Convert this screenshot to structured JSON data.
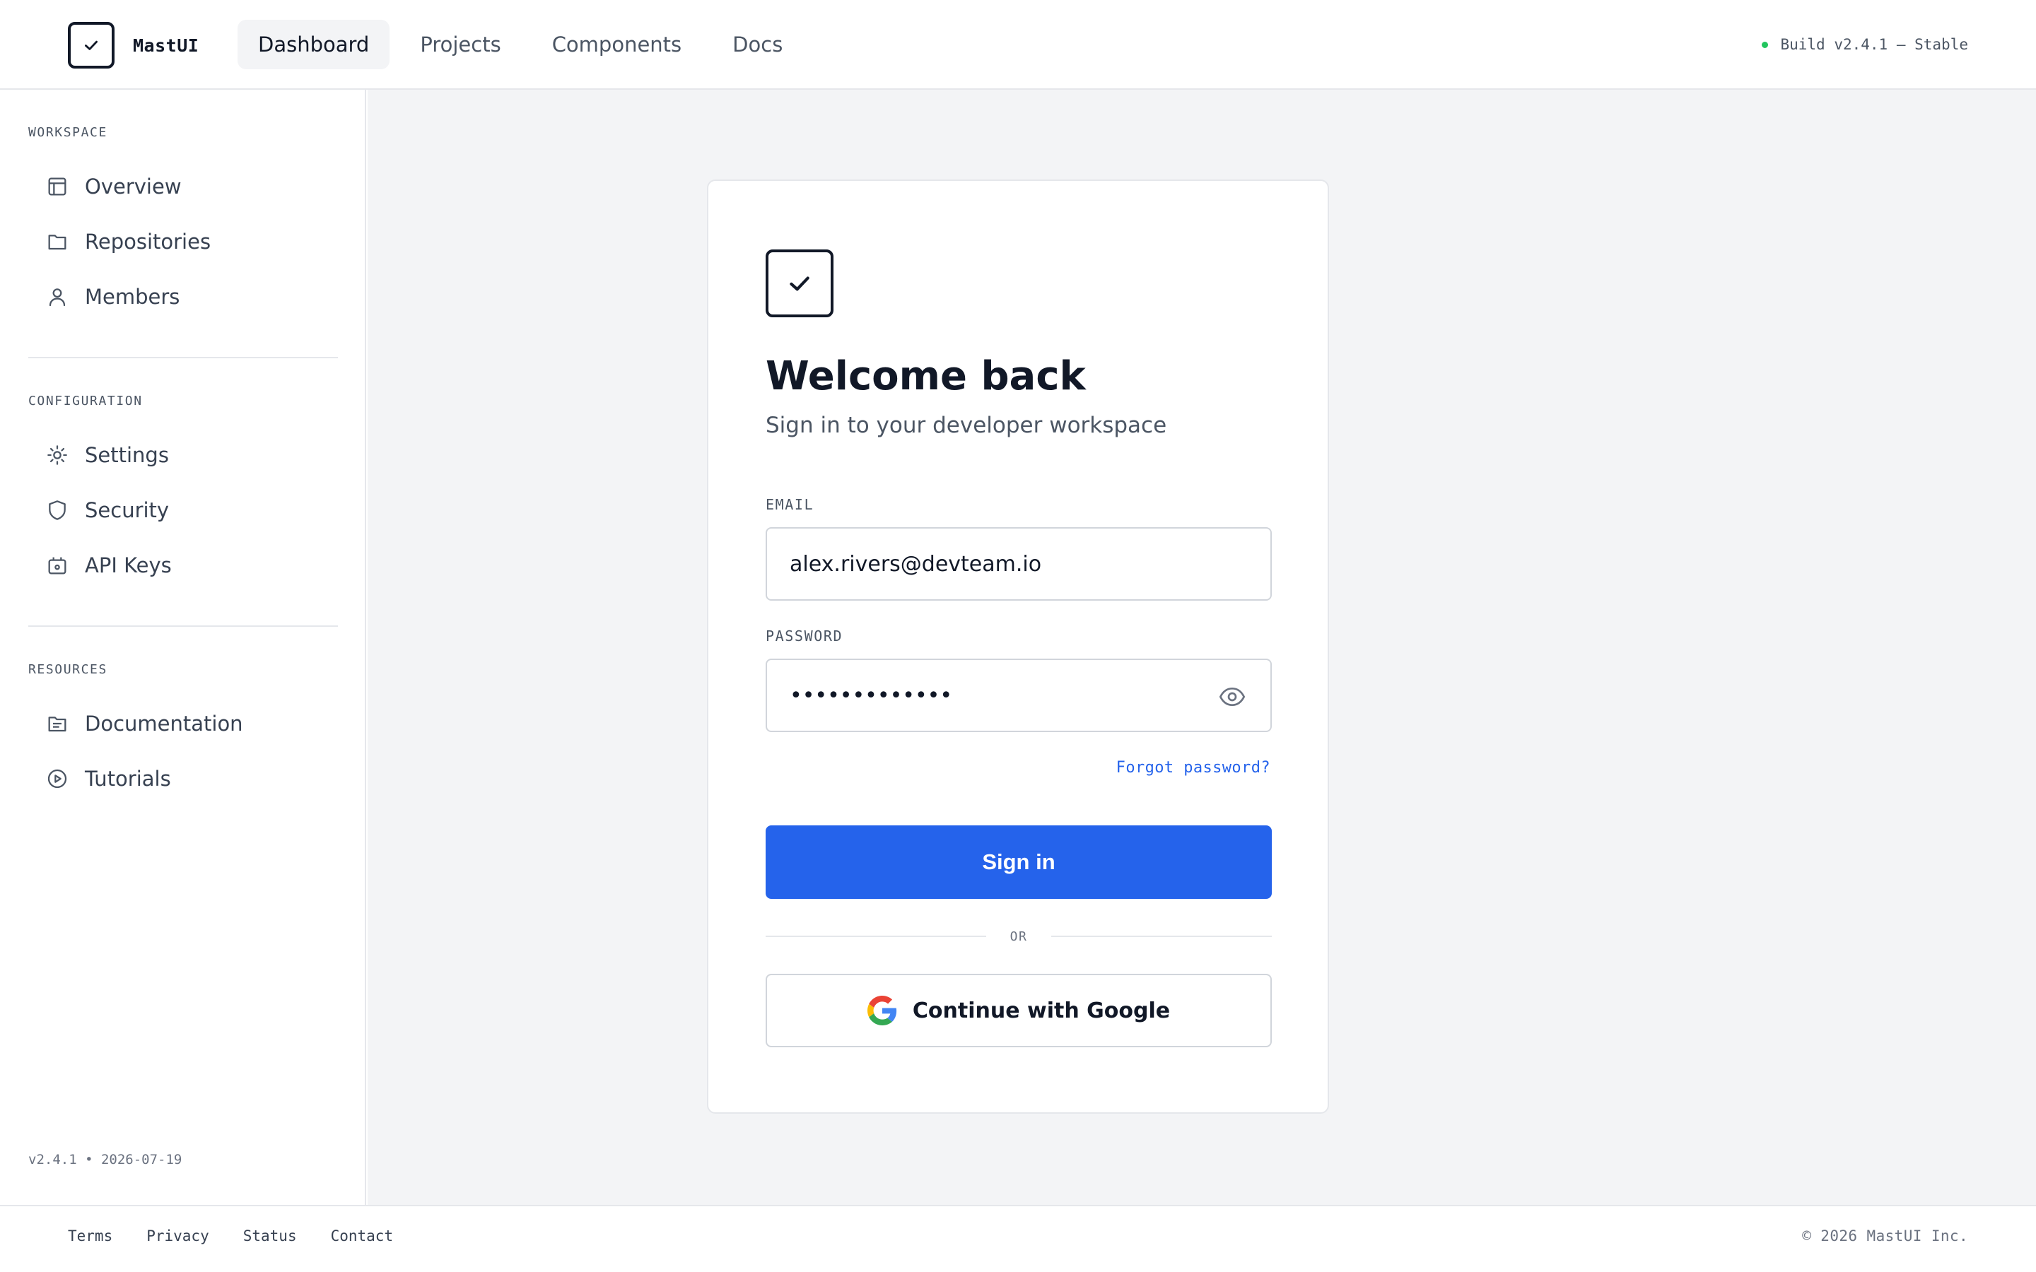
{
  "header": {
    "brand": "MastUI",
    "nav": [
      {
        "label": "Dashboard",
        "active": true
      },
      {
        "label": "Projects"
      },
      {
        "label": "Components"
      },
      {
        "label": "Docs"
      }
    ],
    "build_status": "Build v2.4.1 — Stable",
    "status_color": "#22c55e"
  },
  "sidebar": {
    "sections": [
      {
        "title": "WORKSPACE",
        "items": [
          {
            "label": "Overview",
            "icon": "layout-icon"
          },
          {
            "label": "Repositories",
            "icon": "folder-icon"
          },
          {
            "label": "Members",
            "icon": "user-icon"
          }
        ]
      },
      {
        "title": "CONFIGURATION",
        "items": [
          {
            "label": "Settings",
            "icon": "sun-gear-icon"
          },
          {
            "label": "Security",
            "icon": "shield-icon"
          },
          {
            "label": "API Keys",
            "icon": "key-icon"
          }
        ]
      },
      {
        "title": "RESOURCES",
        "items": [
          {
            "label": "Documentation",
            "icon": "document-icon"
          },
          {
            "label": "Tutorials",
            "icon": "play-circle-icon"
          }
        ]
      }
    ],
    "version": "v2.4.1 • 2026-07-19"
  },
  "login": {
    "title": "Welcome back",
    "subtitle": "Sign in to your developer workspace",
    "email_label": "EMAIL",
    "email_value": "alex.rivers@devteam.io",
    "password_label": "PASSWORD",
    "password_value": "•••••••••••••",
    "forgot": "Forgot password?",
    "signin": "Sign in",
    "or": "OR",
    "google": "Continue with Google",
    "accent_color": "#2563eb"
  },
  "footer": {
    "links": [
      "Terms",
      "Privacy",
      "Status",
      "Contact"
    ],
    "copyright": "© 2026 MastUI Inc."
  }
}
